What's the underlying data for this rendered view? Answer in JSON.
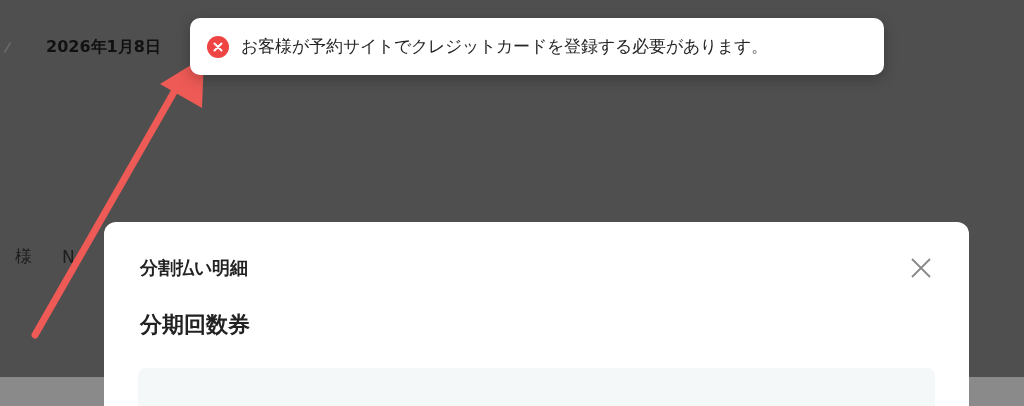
{
  "background": {
    "date": "2026年1月8日",
    "customer_suffix": "様",
    "number": "N"
  },
  "toast": {
    "kind": "error",
    "message": "お客様が予約サイトでクレジットカードを登録する必要があります。"
  },
  "modal": {
    "title": "分割払い明細",
    "product": "分期回数券"
  },
  "annotation": {
    "kind": "arrow"
  }
}
